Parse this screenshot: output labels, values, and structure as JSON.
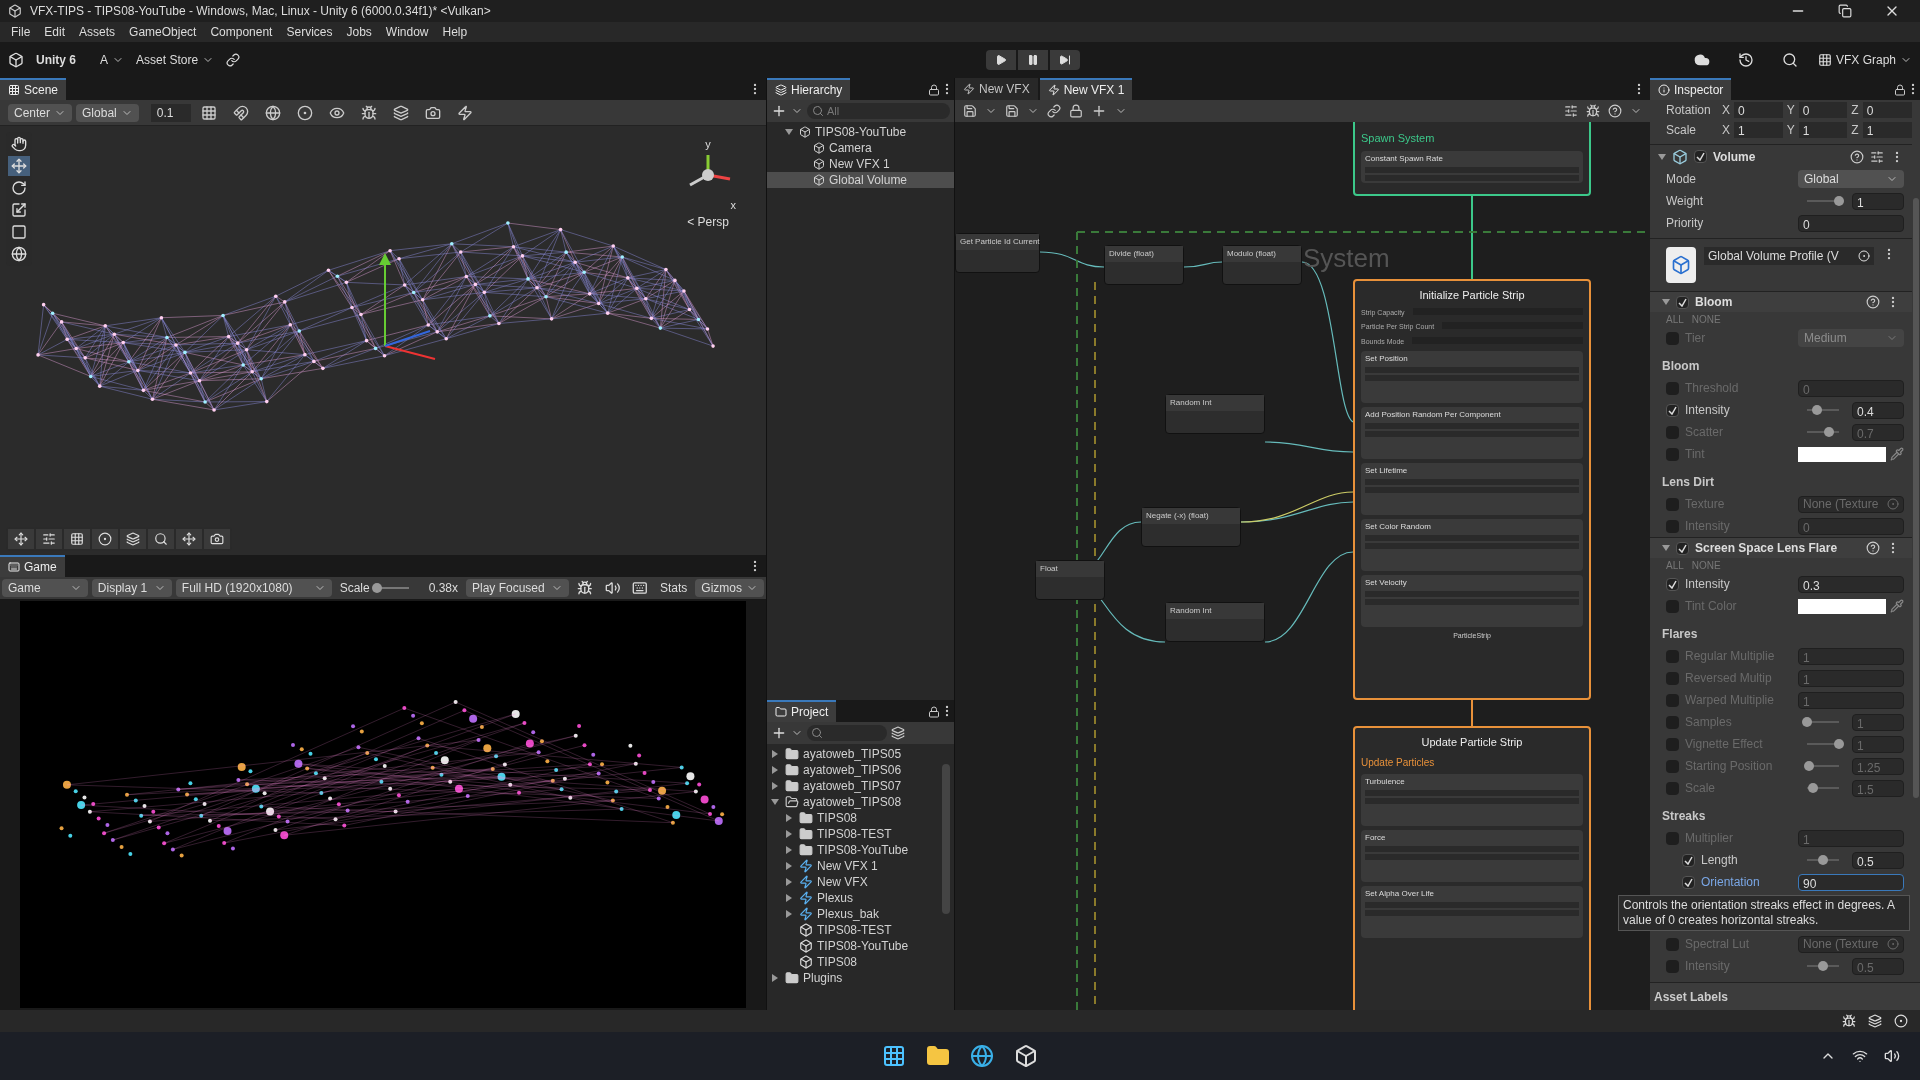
{
  "window": {
    "title": "VFX-TIPS - TIPS08-YouTube - Windows, Mac, Linux - Unity 6 (6000.0.34f1)* <Vulkan>"
  },
  "menu": [
    "File",
    "Edit",
    "Assets",
    "GameObject",
    "Component",
    "Services",
    "Jobs",
    "Window",
    "Help"
  ],
  "toolbar": {
    "brand": "Unity 6",
    "account": "A",
    "store": "Asset Store",
    "layout": "VFX Graph"
  },
  "scene": {
    "tab": "Scene",
    "pivot": "Center",
    "space": "Global",
    "snap": "0.1",
    "axis_y": "y",
    "axis_x": "x",
    "projection": "< Persp"
  },
  "game": {
    "tab": "Game",
    "mode": "Game",
    "display": "Display 1",
    "resolution": "Full HD (1920x1080)",
    "scale_label": "Scale",
    "scale": {
      "level": 0.1
    },
    "scale_value": "0.38x",
    "play_mode": "Play Focused",
    "stats": "Stats",
    "gizmos": "Gizmos"
  },
  "hierarchy": {
    "tab": "Hierarchy",
    "search_placeholder": "All",
    "items": [
      {
        "label": "TIPS08-YouTube",
        "selected": false,
        "expanded": true,
        "children": [
          {
            "label": "Camera",
            "selected": false
          },
          {
            "label": "New VFX 1",
            "selected": false
          },
          {
            "label": "Global Volume",
            "selected": true
          }
        ]
      }
    ]
  },
  "project": {
    "tab": "Project",
    "items": [
      {
        "label": "ayatoweb_TIPS05",
        "kind": "folder",
        "expanded": false
      },
      {
        "label": "ayatoweb_TIPS06",
        "kind": "folder",
        "expanded": false
      },
      {
        "label": "ayatoweb_TIPS07",
        "kind": "folder",
        "expanded": false
      },
      {
        "label": "ayatoweb_TIPS08",
        "kind": "folder",
        "expanded": true,
        "children": [
          {
            "label": "TIPS08",
            "kind": "folder",
            "expanded": false
          },
          {
            "label": "TIPS08-TEST",
            "kind": "folder",
            "expanded": false
          },
          {
            "label": "TIPS08-YouTube",
            "kind": "folder",
            "expanded": false
          },
          {
            "label": "New VFX 1",
            "kind": "vfx",
            "expanded": false
          },
          {
            "label": "New VFX",
            "kind": "vfx",
            "expanded": false
          },
          {
            "label": "Plexus",
            "kind": "vfx",
            "expanded": false
          },
          {
            "label": "Plexus_bak",
            "kind": "vfx",
            "expanded": false
          },
          {
            "label": "TIPS08-TEST",
            "kind": "scene"
          },
          {
            "label": "TIPS08-YouTube",
            "kind": "scene"
          },
          {
            "label": "TIPS08",
            "kind": "scene"
          }
        ]
      },
      {
        "label": "Plugins",
        "kind": "folder",
        "expanded": false
      }
    ]
  },
  "graph": {
    "tabs": [
      {
        "label": "New VFX",
        "selected": false
      },
      {
        "label": "New VFX 1",
        "selected": true
      }
    ],
    "system_label": "System",
    "contexts": [
      {
        "kind": "spawn",
        "title": "Spawn System",
        "blocks": [
          {
            "title": "Constant Spawn Rate"
          }
        ]
      },
      {
        "kind": "initialize",
        "title": "Initialize Particle Strip",
        "settings": [
          "Strip Capacity",
          "Particle Per Strip Count",
          "Bounds Mode"
        ],
        "blocks": [
          {
            "title": "Set Position"
          },
          {
            "title": "Add Position Random Per Component"
          },
          {
            "title": "Set Lifetime"
          },
          {
            "title": "Set Color Random"
          },
          {
            "title": "Set Velocity"
          }
        ],
        "footer": "ParticleStrip"
      },
      {
        "kind": "update",
        "title": "Update Particle Strip",
        "subtitle": "Update Particles",
        "blocks": [
          {
            "title": "Turbulence"
          },
          {
            "title": "Force"
          },
          {
            "title": "Set Alpha Over Life"
          }
        ]
      }
    ],
    "operators": [
      {
        "title": "Get Particle Id Current"
      },
      {
        "title": "Divide (float)"
      },
      {
        "title": "Modulo (float)"
      },
      {
        "title": "Random Int"
      },
      {
        "title": "Negate (-x) (float)"
      },
      {
        "title": "Float"
      },
      {
        "title": "Random Int"
      }
    ]
  },
  "inspector": {
    "tab": "Inspector",
    "transform": [
      {
        "label": "Rotation",
        "axes": [
          {
            "axis": "X",
            "value": "0"
          },
          {
            "axis": "Y",
            "value": "0"
          },
          {
            "axis": "Z",
            "value": "0"
          }
        ]
      },
      {
        "label": "Scale",
        "axes": [
          {
            "axis": "X",
            "value": "1"
          },
          {
            "axis": "Y",
            "value": "1"
          },
          {
            "axis": "Z",
            "value": "1"
          }
        ]
      }
    ],
    "volume": {
      "title": "Volume",
      "enabled": true,
      "rows": [
        {
          "kind": "dropdown",
          "label": "Mode",
          "value": "Global"
        },
        {
          "kind": "slider",
          "label": "Weight",
          "level": 1,
          "value": "1"
        },
        {
          "kind": "field",
          "label": "Priority",
          "value": "0"
        }
      ],
      "profile": "Global Volume Profile (V"
    },
    "overrides": [
      {
        "title": "Bloom",
        "enabled": true,
        "all": "ALL",
        "none": "NONE",
        "rows": [
          {
            "kind": "dropdown",
            "label": "Tier",
            "value": "Medium",
            "checked": false
          },
          {
            "kind": "header",
            "label": "Bloom"
          },
          {
            "kind": "field",
            "label": "Threshold",
            "value": "0",
            "checked": false
          },
          {
            "kind": "slider",
            "label": "Intensity",
            "value": "0.4",
            "level": 0.3,
            "checked": true
          },
          {
            "kind": "slider",
            "label": "Scatter",
            "value": "0.7",
            "level": 0.7,
            "checked": false
          },
          {
            "kind": "color",
            "label": "Tint",
            "checked": false
          },
          {
            "kind": "header",
            "label": "Lens Dirt"
          },
          {
            "kind": "object",
            "label": "Texture",
            "value": "None (Texture",
            "checked": false
          },
          {
            "kind": "field",
            "label": "Intensity",
            "value": "0",
            "checked": false
          }
        ]
      },
      {
        "title": "Screen Space Lens Flare",
        "enabled": true,
        "all": "ALL",
        "none": "NONE",
        "rows": [
          {
            "kind": "field",
            "label": "Intensity",
            "value": "0.3",
            "checked": true
          },
          {
            "kind": "color",
            "label": "Tint Color",
            "checked": false
          },
          {
            "kind": "header",
            "label": "Flares"
          },
          {
            "kind": "field",
            "label": "Regular Multiplie",
            "value": "1",
            "checked": false
          },
          {
            "kind": "field",
            "label": "Reversed Multip",
            "value": "1",
            "checked": false
          },
          {
            "kind": "field",
            "label": "Warped Multiplie",
            "value": "1",
            "checked": false
          },
          {
            "kind": "slider",
            "label": "Samples",
            "value": "1",
            "level": 0,
            "checked": false
          },
          {
            "kind": "slider",
            "label": "Vignette Effect",
            "value": "1",
            "level": 1,
            "checked": false
          },
          {
            "kind": "slider",
            "label": "Starting Position",
            "value": "1.25",
            "level": 0.05,
            "checked": false
          },
          {
            "kind": "slider",
            "label": "Scale",
            "value": "1.5",
            "level": 0.2,
            "checked": false
          },
          {
            "kind": "header",
            "label": "Streaks"
          },
          {
            "kind": "field",
            "label": "Multiplier",
            "value": "1",
            "checked": false
          },
          {
            "kind": "slider",
            "label": "Length",
            "value": "0.5",
            "level": 0.5,
            "checked": true,
            "indent": true
          },
          {
            "kind": "editing",
            "label": "Orientation",
            "value": "90",
            "checked": true,
            "indent": true
          },
          {
            "kind": "object",
            "label": "Spectral Lut",
            "value": "None (Texture",
            "checked": false
          },
          {
            "kind": "slider",
            "label": "Intensity",
            "value": "0.5",
            "level": 0.5,
            "checked": false
          }
        ]
      }
    ],
    "tooltip": "Controls the orientation streaks effect in degrees. A value of 0 creates horizontal streaks.",
    "asset_labels": "Asset Labels"
  }
}
